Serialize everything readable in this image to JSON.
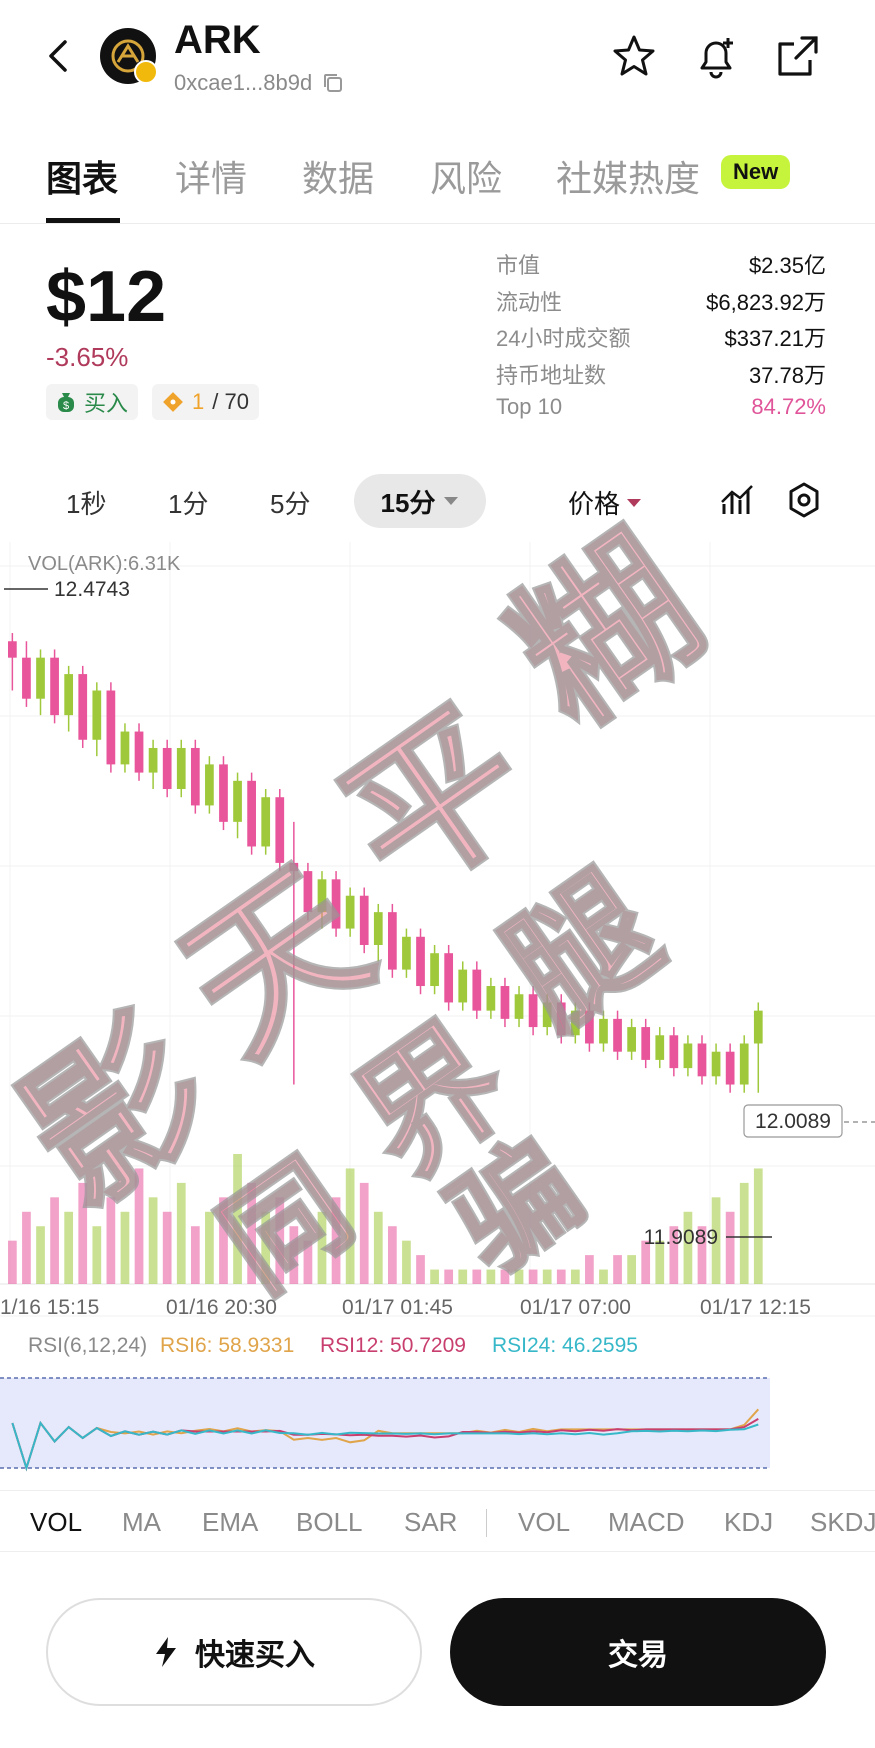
{
  "header": {
    "token_name": "ARK",
    "address": "0xcae1...8b9d",
    "icons": [
      "back-icon",
      "copy-icon",
      "star-icon",
      "bell-plus-icon",
      "share-icon"
    ]
  },
  "tabs": [
    {
      "label": "图表",
      "active": true
    },
    {
      "label": "详情",
      "active": false
    },
    {
      "label": "数据",
      "active": false
    },
    {
      "label": "风险",
      "active": false
    },
    {
      "label": "社媒热度",
      "active": false
    }
  ],
  "new_badge": "New",
  "price": {
    "value": "$12",
    "change": "-3.65%",
    "buy_label": "买入",
    "rank_current": "1",
    "rank_total": "/ 70"
  },
  "stats": [
    {
      "label": "市值",
      "value": "$2.35亿"
    },
    {
      "label": "流动性",
      "value": "$6,823.92万"
    },
    {
      "label": "24小时成交额",
      "value": "$337.21万"
    },
    {
      "label": "持币地址数",
      "value": "37.78万"
    },
    {
      "label": "Top 10",
      "value": "84.72%"
    }
  ],
  "intervals": [
    "1秒",
    "1分",
    "5分"
  ],
  "interval_selected": "15分",
  "price_toggle": "价格",
  "chart_data": {
    "type": "candlestick",
    "vol_label": "VOL(ARK):6.31K",
    "high_label": "12.4743",
    "low_label": "11.9089",
    "current_label": "12.0089",
    "x_ticks": [
      "1/16 15:15",
      "01/16 20:30",
      "01/17 01:45",
      "01/17 07:00",
      "01/17 12:15"
    ],
    "y_range": [
      11.85,
      12.52
    ],
    "candles": [
      [
        12.46,
        12.47,
        12.4,
        12.44
      ],
      [
        12.44,
        12.46,
        12.38,
        12.39
      ],
      [
        12.39,
        12.45,
        12.37,
        12.44
      ],
      [
        12.44,
        12.45,
        12.36,
        12.37
      ],
      [
        12.37,
        12.43,
        12.35,
        12.42
      ],
      [
        12.42,
        12.43,
        12.33,
        12.34
      ],
      [
        12.34,
        12.41,
        12.32,
        12.4
      ],
      [
        12.4,
        12.41,
        12.3,
        12.31
      ],
      [
        12.31,
        12.36,
        12.3,
        12.35
      ],
      [
        12.35,
        12.36,
        12.29,
        12.3
      ],
      [
        12.3,
        12.34,
        12.28,
        12.33
      ],
      [
        12.33,
        12.34,
        12.27,
        12.28
      ],
      [
        12.28,
        12.34,
        12.27,
        12.33
      ],
      [
        12.33,
        12.34,
        12.25,
        12.26
      ],
      [
        12.26,
        12.32,
        12.25,
        12.31
      ],
      [
        12.31,
        12.32,
        12.23,
        12.24
      ],
      [
        12.24,
        12.3,
        12.22,
        12.29
      ],
      [
        12.29,
        12.3,
        12.2,
        12.21
      ],
      [
        12.21,
        12.28,
        12.2,
        12.27
      ],
      [
        12.27,
        12.28,
        12.18,
        12.19
      ],
      [
        12.19,
        12.24,
        11.92,
        12.18
      ],
      [
        12.18,
        12.19,
        12.12,
        12.13
      ],
      [
        12.13,
        12.18,
        12.11,
        12.17
      ],
      [
        12.17,
        12.18,
        12.1,
        12.11
      ],
      [
        12.11,
        12.16,
        12.1,
        12.15
      ],
      [
        12.15,
        12.16,
        12.08,
        12.09
      ],
      [
        12.09,
        12.14,
        12.07,
        12.13
      ],
      [
        12.13,
        12.14,
        12.05,
        12.06
      ],
      [
        12.06,
        12.11,
        12.05,
        12.1
      ],
      [
        12.1,
        12.11,
        12.03,
        12.04
      ],
      [
        12.04,
        12.09,
        12.03,
        12.08
      ],
      [
        12.08,
        12.09,
        12.01,
        12.02
      ],
      [
        12.02,
        12.07,
        12.01,
        12.06
      ],
      [
        12.06,
        12.07,
        12.0,
        12.01
      ],
      [
        12.01,
        12.05,
        12.0,
        12.04
      ],
      [
        12.04,
        12.05,
        11.99,
        12.0
      ],
      [
        12.0,
        12.04,
        11.99,
        12.03
      ],
      [
        12.03,
        12.04,
        11.98,
        11.99
      ],
      [
        11.99,
        12.03,
        11.98,
        12.02
      ],
      [
        12.02,
        12.03,
        11.97,
        11.98
      ],
      [
        11.98,
        12.02,
        11.97,
        12.01
      ],
      [
        12.01,
        12.02,
        11.96,
        11.97
      ],
      [
        11.97,
        12.01,
        11.96,
        12.0
      ],
      [
        12.0,
        12.01,
        11.95,
        11.96
      ],
      [
        11.96,
        12.0,
        11.95,
        11.99
      ],
      [
        11.99,
        12.0,
        11.94,
        11.95
      ],
      [
        11.95,
        11.99,
        11.94,
        11.98
      ],
      [
        11.98,
        11.99,
        11.93,
        11.94
      ],
      [
        11.94,
        11.98,
        11.93,
        11.97
      ],
      [
        11.97,
        11.98,
        11.92,
        11.93
      ],
      [
        11.93,
        11.97,
        11.92,
        11.96
      ],
      [
        11.96,
        11.97,
        11.91,
        11.92
      ],
      [
        11.92,
        11.98,
        11.91,
        11.97
      ],
      [
        11.97,
        12.02,
        11.91,
        12.01
      ]
    ],
    "volumes": [
      0.3,
      0.5,
      0.4,
      0.6,
      0.5,
      0.7,
      0.4,
      0.6,
      0.5,
      0.8,
      0.6,
      0.5,
      0.7,
      0.4,
      0.5,
      0.6,
      0.9,
      0.7,
      0.5,
      0.6,
      0.4,
      0.3,
      0.5,
      0.6,
      0.8,
      0.7,
      0.5,
      0.4,
      0.3,
      0.2,
      0.1,
      0.1,
      0.1,
      0.1,
      0.1,
      0.1,
      0.1,
      0.1,
      0.1,
      0.1,
      0.1,
      0.2,
      0.1,
      0.2,
      0.2,
      0.3,
      0.3,
      0.4,
      0.5,
      0.4,
      0.6,
      0.5,
      0.7,
      0.8
    ],
    "rsi_label": "RSI(6,12,24)",
    "rsi6": "RSI6: 58.9331",
    "rsi12": "RSI12: 50.7209",
    "rsi24": "RSI24: 46.2595",
    "colors": {
      "up": "#9fc93b",
      "down": "#e8559a",
      "rsi6": "#e0a44a",
      "rsi12": "#c83e6e",
      "rsi24": "#36b8c9"
    }
  },
  "indicators": [
    "VOL",
    "MA",
    "EMA",
    "BOLL",
    "SAR",
    "VOL",
    "MACD",
    "KDJ",
    "SKDJ"
  ],
  "buttons": {
    "quick_buy": "快速买入",
    "trade": "交易"
  },
  "watermark": [
    "影",
    "天",
    "平",
    "糊",
    "界",
    "腿",
    "同",
    "骗"
  ]
}
